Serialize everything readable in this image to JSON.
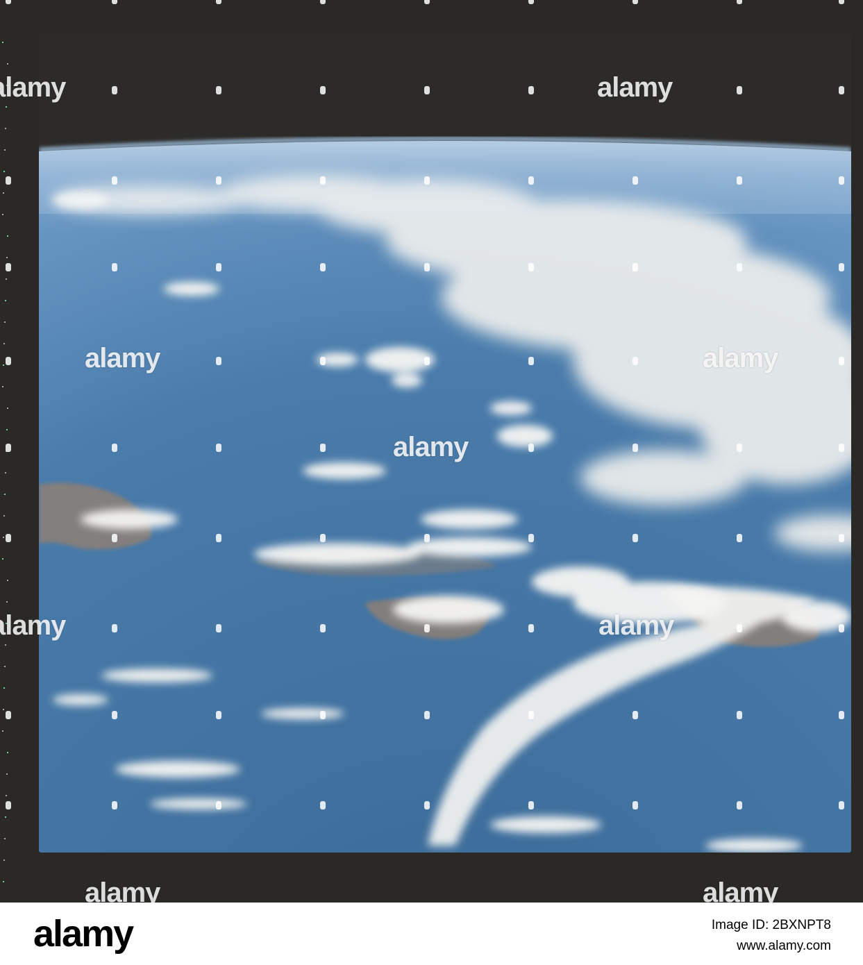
{
  "photo": {
    "subject": "",
    "colors": {
      "space": "#2a2926",
      "ocean": "#3e6f9c",
      "cloud": "#f2f2f0",
      "land": "#8d7f73",
      "limb_glow": "#9ec3e6"
    }
  },
  "watermark": {
    "word": "alamy"
  },
  "stock_bar": {
    "logo": "alamy",
    "image_id": "Image ID: 2BXNPT8",
    "url": "www.alamy.com"
  }
}
